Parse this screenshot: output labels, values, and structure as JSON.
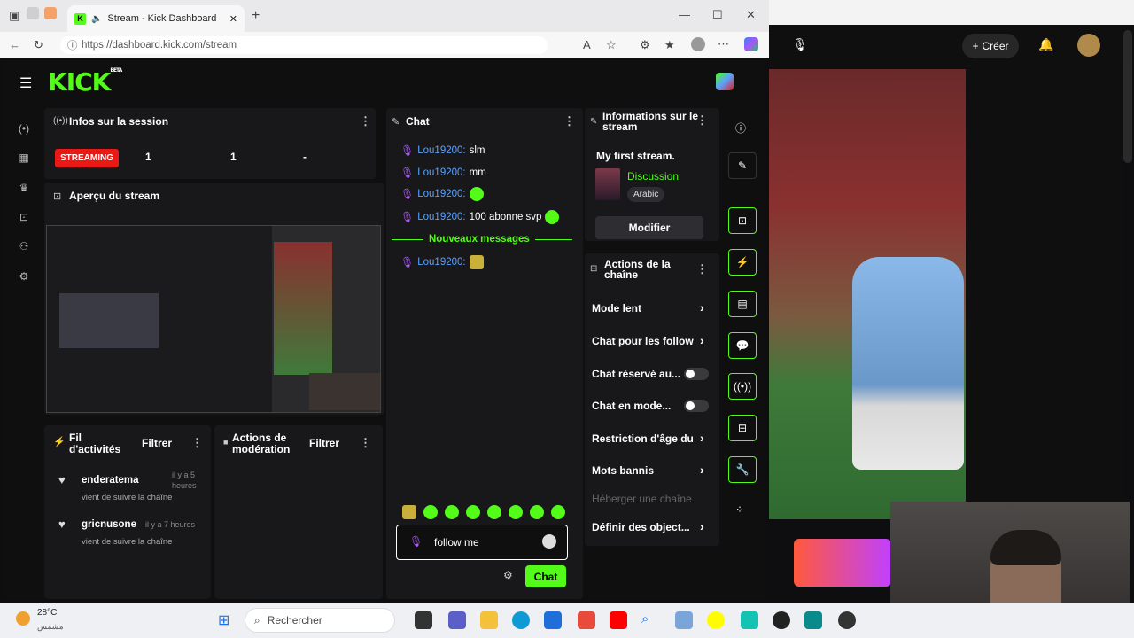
{
  "browser": {
    "tab_title": "Stream - Kick Dashboard",
    "url": "https://dashboard.kick.com/stream"
  },
  "kick": {
    "logo": "KICK",
    "logo_badge": "BETA",
    "session": {
      "title": "Infos sur la session",
      "status": "STREAMING",
      "stats": [
        "1",
        "1",
        "-"
      ]
    },
    "preview_title": "Aperçu du stream",
    "activity": {
      "title": "Fil d'activités",
      "filter": "Filtrer",
      "items": [
        {
          "user": "enderatema",
          "time": "il y a 5 heures",
          "text": "vient de suivre la chaîne"
        },
        {
          "user": "gricnusone",
          "time": "il y a 7 heures",
          "text": "vient de suivre la chaîne"
        }
      ]
    },
    "moderation": {
      "title": "Actions de modération",
      "filter": "Filtrer"
    },
    "chat": {
      "title": "Chat",
      "messages": [
        {
          "user": "Lou19200:",
          "text": "slm"
        },
        {
          "user": "Lou19200:",
          "text": "mm"
        },
        {
          "user": "Lou19200:",
          "text": ""
        },
        {
          "user": "Lou19200:",
          "text": "100 abonne svp"
        }
      ],
      "new_messages": "Nouveaux messages",
      "after_messages": [
        {
          "user": "Lou19200:",
          "text": ""
        }
      ],
      "input_value": "follow me",
      "send_label": "Chat"
    },
    "stream_info": {
      "title": "Informations sur le stream",
      "stream_title": "My first stream.",
      "category": "Discussion",
      "language": "Arabic",
      "edit_label": "Modifier"
    },
    "channel_actions": {
      "title": "Actions de la chaîne",
      "items": [
        {
          "label": "Mode lent",
          "control": "arrow"
        },
        {
          "label": "Chat pour les follow",
          "control": "arrow"
        },
        {
          "label": "Chat réservé au...",
          "control": "toggle"
        },
        {
          "label": "Chat en mode...",
          "control": "toggle"
        },
        {
          "label": "Restriction d'âge du",
          "control": "arrow"
        },
        {
          "label": "Mots bannis",
          "control": "arrow"
        },
        {
          "label": "Héberger une chaîne",
          "control": "none"
        },
        {
          "label": "Définir des object...",
          "control": "arrow"
        }
      ]
    }
  },
  "youtube": {
    "create_label": "Créer"
  },
  "taskbar": {
    "weather_temp": "28°C",
    "weather_text": "مشمس",
    "search_placeholder": "Rechercher"
  },
  "colors": {
    "accent": "#53fc18",
    "live": "#e91916",
    "username": "#5aa2ff"
  }
}
